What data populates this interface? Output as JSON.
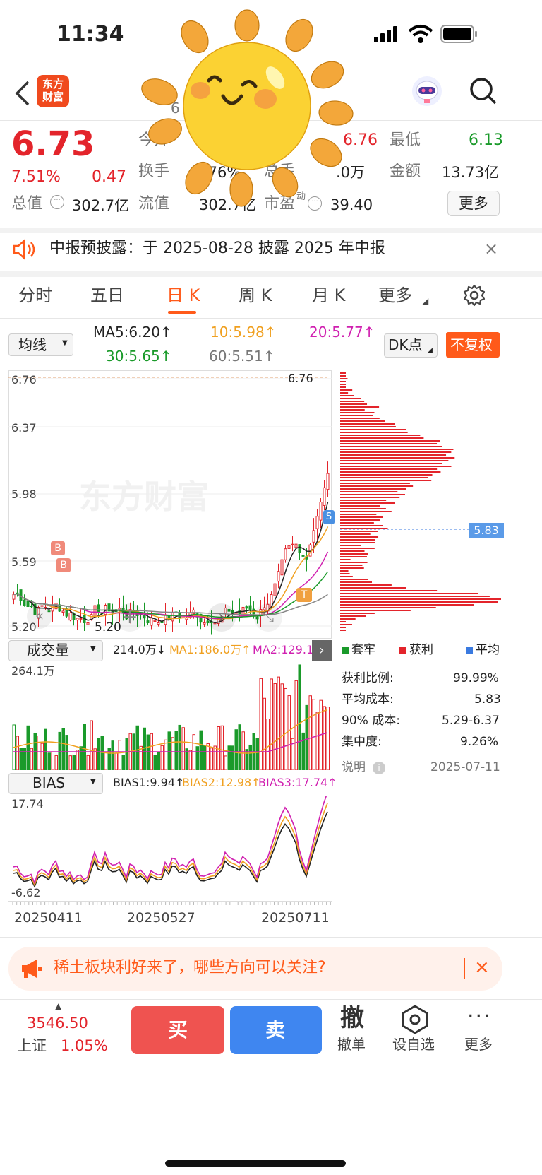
{
  "status": {
    "time": "11:34"
  },
  "header": {
    "logo_line1": "东方",
    "logo_line2": "财富",
    "code": "6"
  },
  "quote": {
    "price": "6.73",
    "pct": "7.51%",
    "chg": "0.47",
    "open_label": "今开",
    "high": "6.76",
    "low_label": "最低",
    "low": "6.13",
    "turnover_label": "换手",
    "turnover": ".76%",
    "vol_label": "总手",
    "vol": ".0万",
    "amount_label": "金额",
    "amount": "13.73亿",
    "mktcap_label": "总值",
    "mktcap": "302.7亿",
    "float_label": "流值",
    "float": "302.7亿",
    "pe_label": "市盈",
    "pe_sup": "动",
    "pe": "39.40",
    "more": "更多"
  },
  "notice": {
    "text": "中报预披露：于 2025-08-28 披露 2025 年中报"
  },
  "tabs": [
    {
      "label": "分时"
    },
    {
      "label": "五日"
    },
    {
      "label": "日 K"
    },
    {
      "label": "周 K"
    },
    {
      "label": "月 K"
    },
    {
      "label": "更多"
    }
  ],
  "ma": {
    "select": "均线",
    "ma5": "MA5:6.20↑",
    "ma10": "10:5.98↑",
    "ma20": "20:5.77↑",
    "ma30": "30:5.65↑",
    "ma60": "60:5.51↑",
    "dk": "DK点",
    "fq": "不复权"
  },
  "kline": {
    "y_labels": [
      "6.76",
      "6.37",
      "5.98",
      "5.59",
      "5.20"
    ],
    "high_mark": "6.76",
    "low_mark": "5.20",
    "watermark": "东方财富",
    "b": "B",
    "s": "S",
    "t": "T",
    "avg_tag": "5.83"
  },
  "volume": {
    "select": "成交量",
    "v": "214.0万↓",
    "ma1": "MA1:186.0万↑",
    "ma2": "MA2:129.1万",
    "max": "264.1万"
  },
  "bias": {
    "select": "BIAS",
    "b1": "BIAS1:9.94↑",
    "b2": "BIAS2:12.98↑",
    "b3": "BIAS3:17.74↑",
    "max": "17.74",
    "min": "-6.62"
  },
  "dates": [
    "20250411",
    "20250527",
    "20250711"
  ],
  "chips": {
    "legend": [
      "套牢",
      "获利",
      "平均"
    ],
    "rows": [
      {
        "k": "获利比例:",
        "v": "99.99%"
      },
      {
        "k": "平均成本:",
        "v": "5.83"
      },
      {
        "k": "90% 成本:",
        "v": "5.29-6.37"
      },
      {
        "k": "集中度:",
        "v": "9.26%"
      }
    ],
    "note": "说明",
    "date": "2025-07-11"
  },
  "banner": {
    "text": "稀土板块利好来了，哪些方向可以关注?"
  },
  "bottom": {
    "index_val": "3546.50",
    "index_name": "上证",
    "index_pct": "1.05%",
    "buy": "买",
    "sell": "卖",
    "cancel_icon": "撤",
    "cancel": "撤单",
    "fav": "设自选",
    "more": "更多"
  },
  "colors": {
    "up": "#e3242b",
    "down": "#1a9a2a",
    "ma10": "#f0a020",
    "ma20": "#d020b0",
    "accent": "#ff5a1a"
  }
}
